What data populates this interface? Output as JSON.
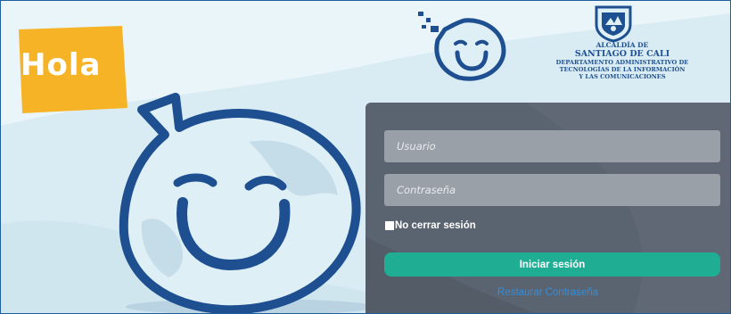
{
  "greeting": "Hola",
  "org": {
    "line1": "ALCALDÍA DE",
    "line2": "SANTIAGO DE CALI",
    "line3": "DEPARTAMENTO ADMINISTRATIVO DE",
    "line4": "TECNOLOGÍAS DE LA INFORMACIÓN",
    "line5": "Y LAS COMUNICACIONES"
  },
  "login": {
    "username_placeholder": "Usuario",
    "password_placeholder": "Contraseña",
    "remember_label": "No cerrar sesión",
    "remember_checked": false,
    "submit_label": "Iniciar sesión",
    "restore_link": "Restaurar Contraseña"
  },
  "colors": {
    "background": "#d9ecf3",
    "hola_badge": "#f7b326",
    "mascot_outline": "#1d4f91",
    "panel": "#5a6370",
    "input": "#9aa0a8",
    "button": "#1fae94",
    "link": "#2f8fe0"
  },
  "icons": {
    "mascot_large": "water-drop-mascot-icon",
    "mascot_small": "water-drop-logo-icon",
    "crest": "coat-of-arms-icon",
    "checkbox": "checkbox-icon"
  }
}
